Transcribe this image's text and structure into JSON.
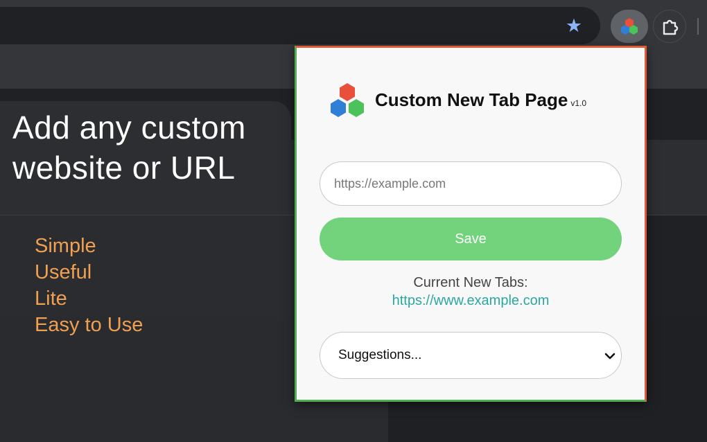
{
  "browser": {
    "bookmark_icon": "star-icon",
    "extension_icon": "hexagon-logo-icon",
    "extensions_menu_icon": "puzzle-icon"
  },
  "background_page": {
    "hero_line1": "Add any custom",
    "hero_line2": "website or URL",
    "features": [
      "Simple",
      "Useful",
      "Lite",
      "Easy to Use"
    ]
  },
  "popup": {
    "title": "Custom New Tab Page",
    "version": "v1.0",
    "url_input": {
      "placeholder": "https://example.com",
      "value": ""
    },
    "save_label": "Save",
    "current_label": "Current New Tabs:",
    "current_url": "https://www.example.com",
    "suggestions_selected": "Suggestions..."
  },
  "colors": {
    "accent_green": "#73d37c",
    "link": "#2aa8a0",
    "feature_orange": "#f0a050",
    "border_red": "#e05a3a",
    "border_green": "#4caf50"
  }
}
